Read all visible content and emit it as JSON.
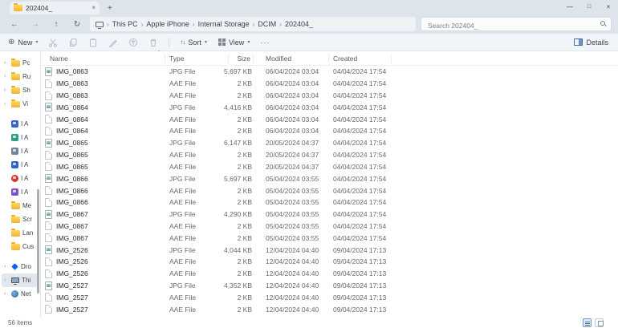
{
  "tab_bar": {
    "tab_label": "202404_",
    "close_glyph": "×",
    "new_tab_glyph": "+"
  },
  "window_controls": {
    "minimize": "—",
    "maximize": "□",
    "close": "×"
  },
  "nav": {
    "back_glyph": "←",
    "forward_glyph": "→",
    "up_glyph": "↑",
    "refresh_glyph": "↻",
    "separator": "›",
    "breadcrumbs": [
      {
        "label": "This PC"
      },
      {
        "label": "Apple iPhone"
      },
      {
        "label": "Internal Storage"
      },
      {
        "label": "DCIM"
      },
      {
        "label": "202404_"
      }
    ],
    "search_placeholder": "Search 202404_"
  },
  "toolbar": {
    "new_label": "New",
    "new_glyph": "⊕",
    "chevron": "▾",
    "sort_label": "Sort",
    "sort_glyph": "↑↓",
    "view_label": "View",
    "more_glyph": "···",
    "details_label": "Details"
  },
  "columns": [
    "Name",
    "Type",
    "Size",
    "Modified",
    "Created"
  ],
  "sidebar": {
    "pinned": [
      {
        "label": "Pc"
      },
      {
        "label": "Ru"
      },
      {
        "label": "Sh"
      },
      {
        "label": "Vi"
      }
    ],
    "apps": [
      {
        "label": "I A",
        "color": "#3468c9"
      },
      {
        "label": "I A",
        "color": "#2c9c83"
      },
      {
        "label": "I A",
        "color": "#7083a0"
      },
      {
        "label": "I A",
        "color": "#2e63c9"
      },
      {
        "label": "I A",
        "color": "#d9392b",
        "shape": "round"
      },
      {
        "label": "I A",
        "color": "#7a54cc"
      }
    ],
    "libraries": [
      {
        "label": "Me"
      },
      {
        "label": "Scr"
      },
      {
        "label": "Lan"
      },
      {
        "label": "Cus"
      }
    ],
    "system": [
      {
        "label": "Dro",
        "icon": "dropbox"
      },
      {
        "label": "Thi",
        "icon": "thispc",
        "state": "selected"
      },
      {
        "label": "Net",
        "icon": "network"
      }
    ]
  },
  "files": [
    {
      "name": "IMG_0863",
      "type": "JPG File",
      "size": "5,697 KB",
      "modified": "06/04/2024 03:04",
      "created": "04/04/2024 17:54",
      "icon": "jpg"
    },
    {
      "name": "IMG_0863",
      "type": "AAE File",
      "size": "2 KB",
      "modified": "06/04/2024 03:04",
      "created": "04/04/2024 17:54",
      "icon": "aae"
    },
    {
      "name": "IMG_0863",
      "type": "AAE File",
      "size": "2 KB",
      "modified": "06/04/2024 03:04",
      "created": "04/04/2024 17:54",
      "icon": "aae"
    },
    {
      "name": "IMG_0864",
      "type": "JPG File",
      "size": "4,416 KB",
      "modified": "06/04/2024 03:04",
      "created": "04/04/2024 17:54",
      "icon": "jpg"
    },
    {
      "name": "IMG_0864",
      "type": "AAE File",
      "size": "2 KB",
      "modified": "06/04/2024 03:04",
      "created": "04/04/2024 17:54",
      "icon": "aae"
    },
    {
      "name": "IMG_0864",
      "type": "AAE File",
      "size": "2 KB",
      "modified": "06/04/2024 03:04",
      "created": "04/04/2024 17:54",
      "icon": "aae"
    },
    {
      "name": "IMG_0865",
      "type": "JPG File",
      "size": "6,147 KB",
      "modified": "20/05/2024 04:37",
      "created": "04/04/2024 17:54",
      "icon": "jpg"
    },
    {
      "name": "IMG_0865",
      "type": "AAE File",
      "size": "2 KB",
      "modified": "20/05/2024 04:37",
      "created": "04/04/2024 17:54",
      "icon": "aae"
    },
    {
      "name": "IMG_0865",
      "type": "AAE File",
      "size": "2 KB",
      "modified": "20/05/2024 04:37",
      "created": "04/04/2024 17:54",
      "icon": "aae"
    },
    {
      "name": "IMG_0866",
      "type": "JPG File",
      "size": "5,697 KB",
      "modified": "05/04/2024 03:55",
      "created": "04/04/2024 17:54",
      "icon": "jpg"
    },
    {
      "name": "IMG_0866",
      "type": "AAE File",
      "size": "2 KB",
      "modified": "05/04/2024 03:55",
      "created": "04/04/2024 17:54",
      "icon": "aae"
    },
    {
      "name": "IMG_0866",
      "type": "AAE File",
      "size": "2 KB",
      "modified": "05/04/2024 03:55",
      "created": "04/04/2024 17:54",
      "icon": "aae"
    },
    {
      "name": "IMG_0867",
      "type": "JPG File",
      "size": "4,290 KB",
      "modified": "05/04/2024 03:55",
      "created": "04/04/2024 17:54",
      "icon": "jpg"
    },
    {
      "name": "IMG_0867",
      "type": "AAE File",
      "size": "2 KB",
      "modified": "05/04/2024 03:55",
      "created": "04/04/2024 17:54",
      "icon": "aae"
    },
    {
      "name": "IMG_0867",
      "type": "AAE File",
      "size": "2 KB",
      "modified": "05/04/2024 03:55",
      "created": "04/04/2024 17:54",
      "icon": "aae"
    },
    {
      "name": "IMG_2526",
      "type": "JPG File",
      "size": "4,044 KB",
      "modified": "12/04/2024 04:40",
      "created": "09/04/2024 17:13",
      "icon": "jpg"
    },
    {
      "name": "IMG_2526",
      "type": "AAE File",
      "size": "2 KB",
      "modified": "12/04/2024 04:40",
      "created": "09/04/2024 17:13",
      "icon": "aae"
    },
    {
      "name": "IMG_2526",
      "type": "AAE File",
      "size": "2 KB",
      "modified": "12/04/2024 04:40",
      "created": "09/04/2024 17:13",
      "icon": "aae"
    },
    {
      "name": "IMG_2527",
      "type": "JPG File",
      "size": "4,352 KB",
      "modified": "12/04/2024 04:40",
      "created": "09/04/2024 17:13",
      "icon": "jpg"
    },
    {
      "name": "IMG_2527",
      "type": "AAE File",
      "size": "2 KB",
      "modified": "12/04/2024 04:40",
      "created": "09/04/2024 17:13",
      "icon": "aae"
    },
    {
      "name": "IMG_2527",
      "type": "AAE File",
      "size": "2 KB",
      "modified": "12/04/2024 04:40",
      "created": "09/04/2024 17:13",
      "icon": "aae"
    }
  ],
  "status": {
    "items_count": "56 items"
  }
}
